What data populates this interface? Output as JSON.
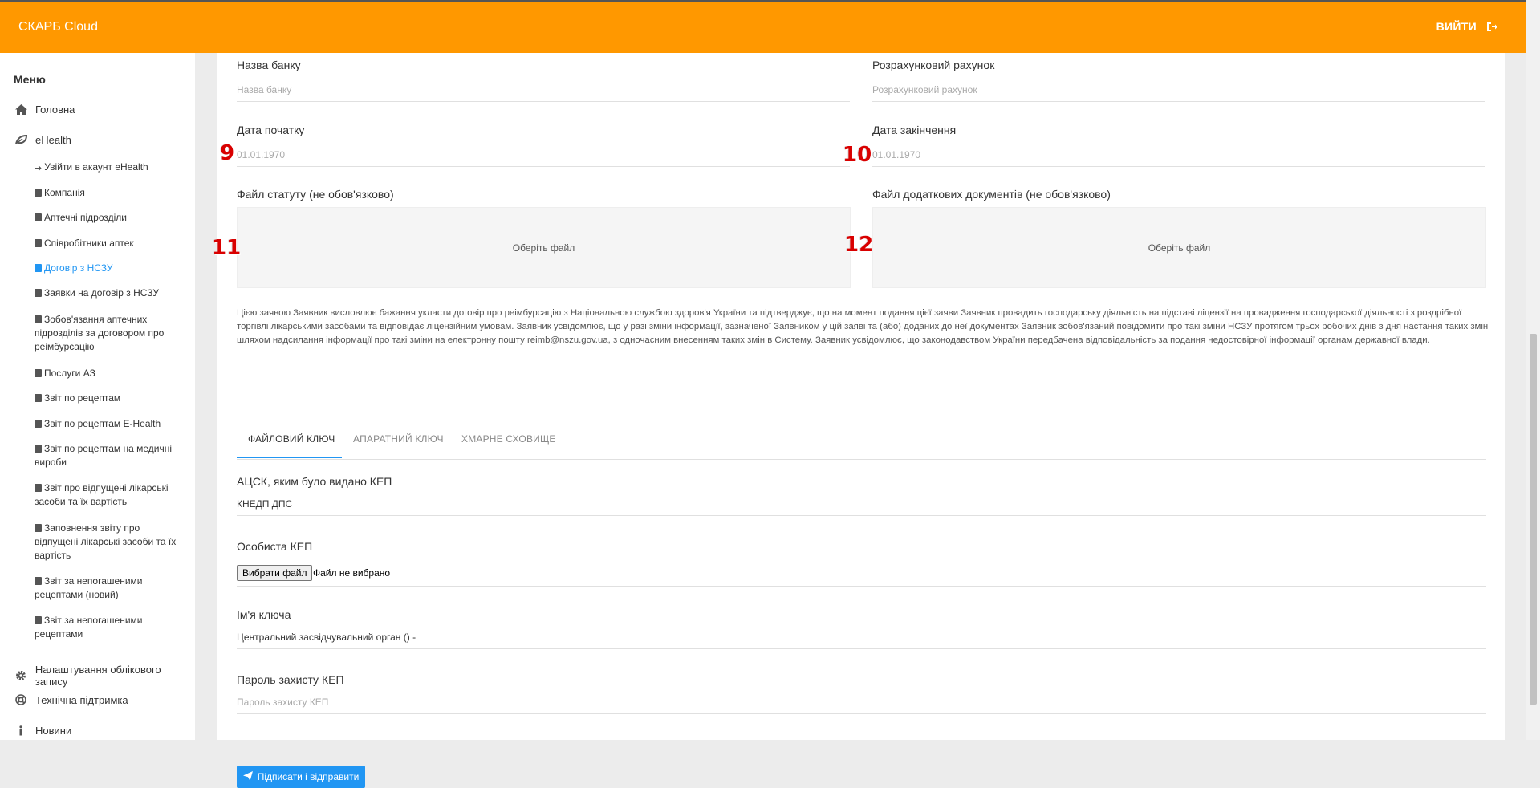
{
  "header": {
    "brand": "СКАРБ Cloud",
    "logout_label": "ВИЙТИ"
  },
  "sidebar": {
    "menu_title": "Меню",
    "home": "Головна",
    "ehealth": "eHealth",
    "ehealth_items": [
      "Увійти в акаунт eHealth",
      "Компанія",
      "Аптечні підрозділи",
      "Співробітники аптек",
      "Договір з НСЗУ",
      "Заявки на договір з НСЗУ",
      "Зобов'язання аптечних підрозділів за договором про реімбурсацію",
      "Послуги АЗ",
      "Звіт по рецептам",
      "Звіт по рецептам E-Health",
      "Звіт по рецептам на медичні вироби",
      "Звіт про відпущені лікарські засоби та їх вартість",
      "Заповнення звіту про відпущені лікарські засоби та їх вартість",
      "Звіт за непогашеними рецептами (новий)",
      "Звіт за непогашеними рецептами"
    ],
    "active_item": "Договір з НСЗУ",
    "settings": "Налаштування облікового запису",
    "support": "Технічна підтримка",
    "news": "Новини"
  },
  "form": {
    "bank_name_label": "Назва банку",
    "bank_name_placeholder": "Назва банку",
    "account_label": "Розрахунковий рахунок",
    "account_placeholder": "Розрахунковий рахунок",
    "start_date_label": "Дата початку",
    "start_date_value": "01.01.1970",
    "end_date_label": "Дата закінчення",
    "end_date_value": "01.01.1970",
    "statute_label": "Файл статуту (не обов'язково)",
    "statute_choose": "Оберіть файл",
    "extra_docs_label": "Файл додаткових документів (не обов'язково)",
    "extra_docs_choose": "Оберіть файл",
    "notice": "Цією заявою Заявник висловлює бажання укласти договір про реімбурсацію з Національною службою здоров'я України та підтверджує, що на момент подання цієї заяви Заявник провадить господарську діяльність на підставі ліцензії на провадження господарської діяльності з роздрібної торгівлі лікарськими засобами та відповідає ліцензійним умовам. Заявник усвідомлює, що у разі зміни інформації, зазначеної Заявником у цій заяві та (або) доданих до неї документах Заявник зобов'язаний повідомити про такі зміни НСЗУ протягом трьох робочих днів з дня настання таких змін шляхом надсилання інформації про такі зміни на електронну пошту reimb@nszu.gov.ua, з одночасним внесенням таких змін в Систему. Заявник усвідомлює, що законодавством України передбачена відповідальність за подання недостовірної інформації органам державної влади."
  },
  "markers": [
    "9",
    "10",
    "11",
    "12"
  ],
  "tabs": [
    "ФАЙЛОВИЙ КЛЮЧ",
    "АПАРАТНИЙ КЛЮЧ",
    "ХМАРНЕ СХОВИЩЕ"
  ],
  "key": {
    "acsk_label": "АЦСК, яким було видано КЕП",
    "acsk_value": "КНЕДП ДПС",
    "personal_key_label": "Особиста КЕП",
    "choose_file_button": "Вибрати файл",
    "no_file_text": "Файл не вибрано",
    "key_name_label": "Ім'я ключа",
    "key_name_value": "Центральний засвідчувальний орган () -",
    "password_label": "Пароль захисту КЕП",
    "password_placeholder": "Пароль захисту КЕП"
  },
  "submit_label": "Підписати і відправити",
  "colors": {
    "header": "#ff9800",
    "accent": "#2196f3",
    "marker": "#d90000"
  }
}
